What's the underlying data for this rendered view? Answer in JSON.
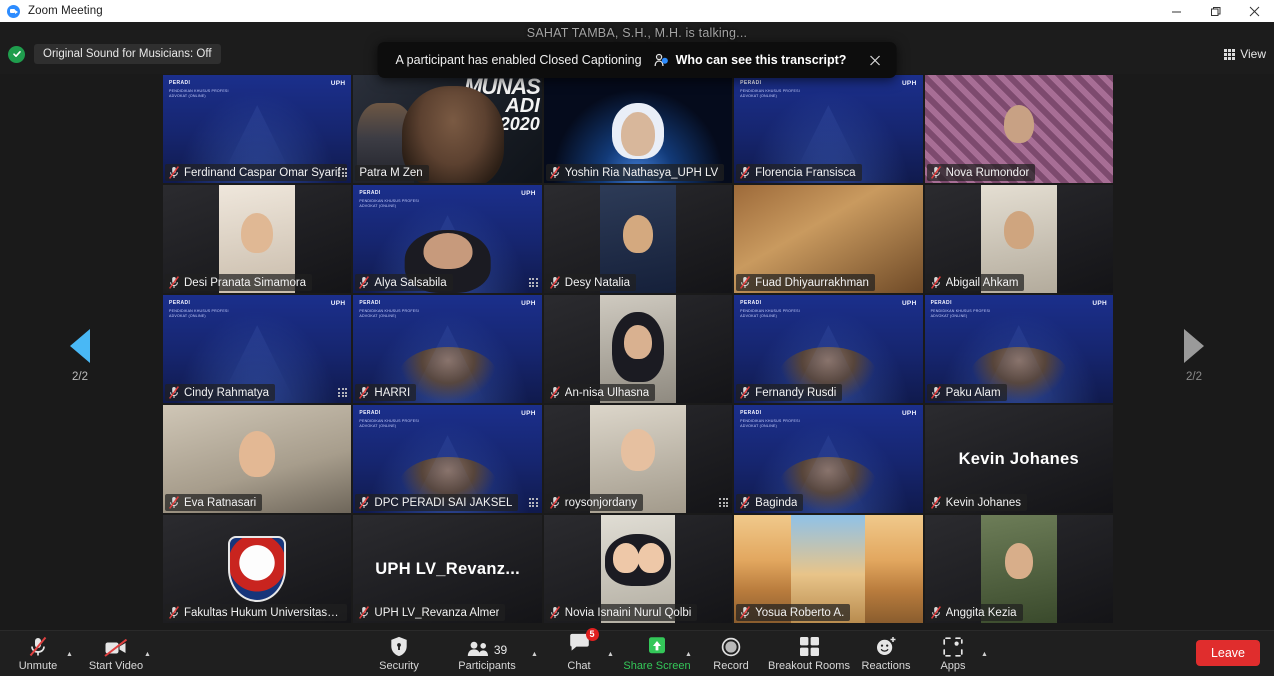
{
  "window": {
    "title": "Zoom Meeting",
    "minimize_icon": "minimize-icon",
    "restore_icon": "restore-icon",
    "close_icon": "close-icon"
  },
  "header": {
    "original_sound_label": "Original Sound for Musicians: Off",
    "original_sound_status_icon": "check-circle-icon",
    "view_label": "View",
    "view_icon": "grid-icon",
    "talking_status": "SAHAT TAMBA, S.H., M.H. is talking..."
  },
  "notification": {
    "message": "A participant has enabled Closed Captioning",
    "link_label": "Who can see this transcript?",
    "link_icon": "person-icon",
    "close_icon": "close-icon"
  },
  "pager": {
    "prev_icon": "triangle-left-icon",
    "next_icon": "triangle-right-icon",
    "prev_page": "2/2",
    "next_page": "2/2"
  },
  "gallery": {
    "mic_muted_icon": "microphone-muted-icon",
    "drag_handle_icon": "drag-handle-icon",
    "virtual_bg": {
      "org_line1": "PERADI",
      "org_line2": "PENDIDIKAN KHUSUS PROFESI ADVOKAT (ONLINE)",
      "uph_mark": "UPH"
    },
    "munas_banner": {
      "line1": "MUNAS",
      "line2": "ADI",
      "line3": "2020"
    },
    "tiles": [
      {
        "name": "Ferdinand Caspar Omar Syarif",
        "muted": true,
        "handle": true,
        "style": "vbg"
      },
      {
        "name": "Patra M Zen",
        "muted": false,
        "handle": false,
        "style": "munas"
      },
      {
        "name": "Yoshin Ria Nathasya_UPH LV",
        "muted": true,
        "handle": false,
        "style": "space"
      },
      {
        "name": "Florencia Fransisca",
        "muted": true,
        "handle": false,
        "style": "vbg"
      },
      {
        "name": "Nova Rumondor",
        "muted": true,
        "handle": false,
        "style": "check"
      },
      {
        "name": "Desi Pranata Simamora",
        "muted": true,
        "handle": false,
        "style": "portrait-cream"
      },
      {
        "name": "Alya Salsabila",
        "muted": true,
        "handle": true,
        "style": "vbg-hijab"
      },
      {
        "name": "Desy Natalia",
        "muted": true,
        "handle": false,
        "style": "portrait-dark"
      },
      {
        "name": "Fuad Dhiyaurrakhman",
        "muted": true,
        "handle": false,
        "style": "camel"
      },
      {
        "name": "Abigail Ahkam",
        "muted": true,
        "handle": false,
        "style": "portrait-office"
      },
      {
        "name": "Cindy Rahmatya",
        "muted": true,
        "handle": true,
        "style": "vbg"
      },
      {
        "name": "HARRI",
        "muted": true,
        "handle": false,
        "style": "vbg-person"
      },
      {
        "name": "An-nisa Ulhasna",
        "muted": true,
        "handle": false,
        "style": "portrait-hijab"
      },
      {
        "name": "Fernandy Rusdi",
        "muted": true,
        "handle": false,
        "style": "vbg-person"
      },
      {
        "name": "Paku Alam",
        "muted": true,
        "handle": false,
        "style": "vbg-person"
      },
      {
        "name": "Eva Ratnasari",
        "muted": true,
        "handle": false,
        "style": "room"
      },
      {
        "name": "DPC PERADI SAI JAKSEL",
        "muted": true,
        "handle": true,
        "style": "vbg-person"
      },
      {
        "name": "roysonjordany",
        "muted": true,
        "handle": true,
        "style": "portrait-green"
      },
      {
        "name": "Baginda",
        "muted": true,
        "handle": false,
        "style": "vbg-person"
      },
      {
        "name": "Kevin Johanes",
        "muted": true,
        "handle": false,
        "style": "name-only",
        "display_name": "Kevin Johanes"
      },
      {
        "name": "Fakultas Hukum Universitas Pelita ...",
        "muted": true,
        "handle": false,
        "style": "crest"
      },
      {
        "name": "UPH LV_Revanza Almer",
        "muted": true,
        "handle": false,
        "style": "name-only",
        "display_name": "UPH  LV_Revanz..."
      },
      {
        "name": "Novia Isnaini Nurul Qolbi",
        "muted": true,
        "handle": false,
        "style": "portrait-two"
      },
      {
        "name": "Yosua Roberto A.",
        "muted": true,
        "handle": false,
        "style": "beach"
      },
      {
        "name": "Anggita Kezia",
        "muted": true,
        "handle": false,
        "style": "portrait-green2"
      }
    ]
  },
  "toolbar": {
    "items": [
      {
        "label": "Unmute",
        "icon": "microphone-muted-icon",
        "caret": true,
        "accent": ""
      },
      {
        "label": "Start Video",
        "icon": "video-off-icon",
        "caret": true,
        "accent": ""
      },
      {
        "label": "Security",
        "icon": "shield-icon",
        "caret": false,
        "accent": ""
      },
      {
        "label": "Participants",
        "icon": "participants-icon",
        "caret": true,
        "accent": "",
        "count": "39"
      },
      {
        "label": "Chat",
        "icon": "chat-icon",
        "caret": true,
        "accent": "",
        "badge": "5"
      },
      {
        "label": "Share Screen",
        "icon": "share-screen-icon",
        "caret": true,
        "accent": "green"
      },
      {
        "label": "Record",
        "icon": "record-icon",
        "caret": false,
        "accent": ""
      },
      {
        "label": "Breakout Rooms",
        "icon": "breakout-rooms-icon",
        "caret": false,
        "accent": ""
      },
      {
        "label": "Reactions",
        "icon": "reactions-icon",
        "caret": false,
        "accent": ""
      },
      {
        "label": "Apps",
        "icon": "apps-icon",
        "caret": true,
        "accent": ""
      }
    ],
    "leave_label": "Leave"
  },
  "colors": {
    "accent_blue": "#2d8cff",
    "leave_red": "#e02d2d",
    "share_green": "#34c759",
    "badge_red": "#e02020",
    "pager_active": "#49b8f5"
  }
}
